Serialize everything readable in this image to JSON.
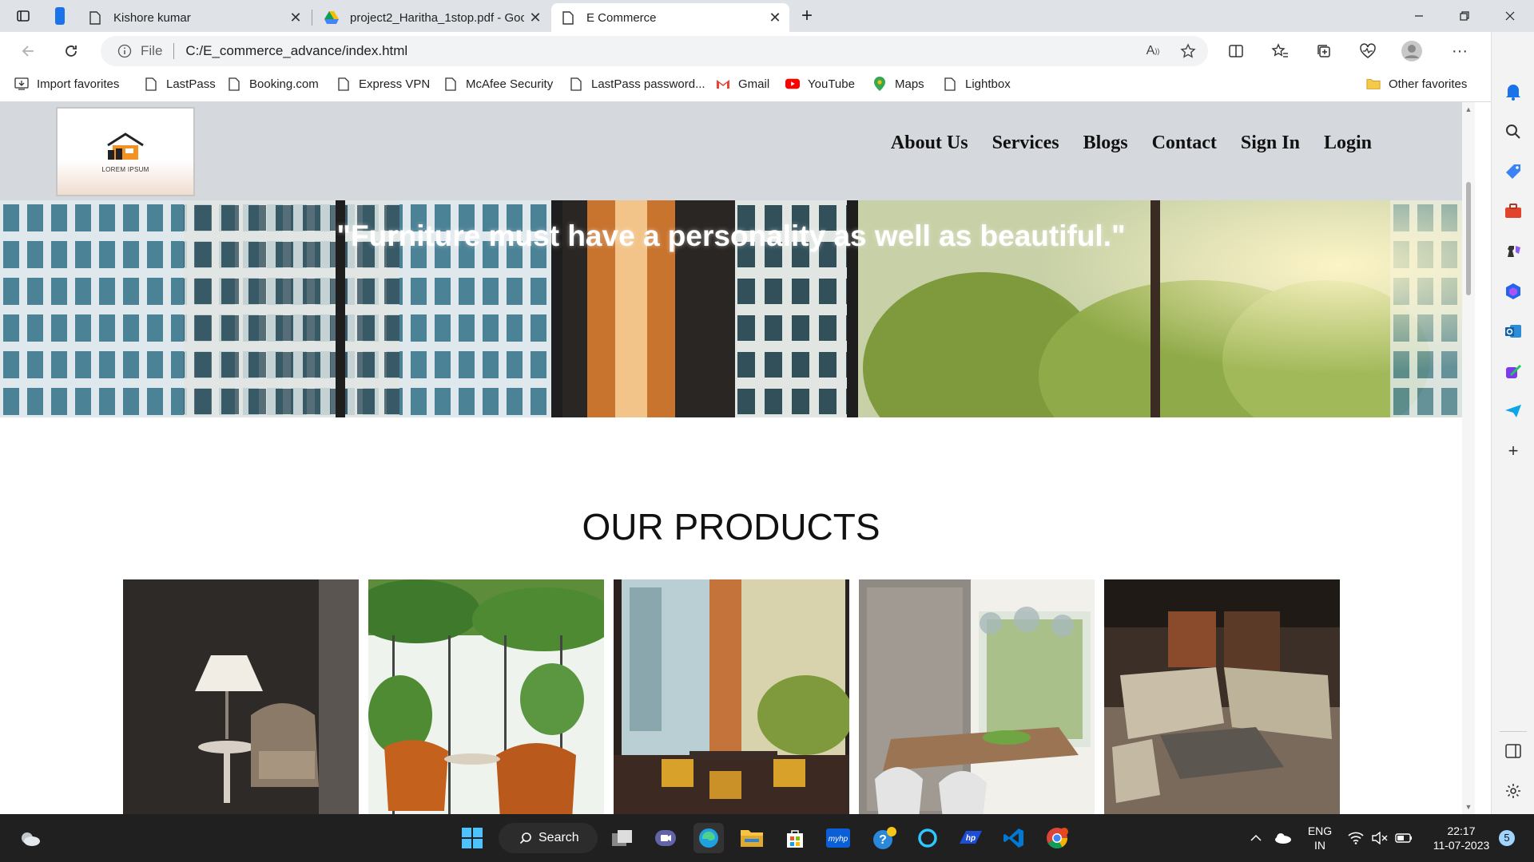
{
  "browser": {
    "tabs": [
      {
        "label": "Kishore kumar",
        "active": false
      },
      {
        "label": "project2_Haritha_1stop.pdf - Goo",
        "active": false
      },
      {
        "label": "E Commerce",
        "active": true
      }
    ],
    "address": {
      "scheme_label": "File",
      "url": "C:/E_commerce_advance/index.html"
    },
    "favorites": [
      {
        "label": "Import favorites",
        "icon": "import-icon"
      },
      {
        "label": "LastPass",
        "icon": "page-icon"
      },
      {
        "label": "Booking.com",
        "icon": "page-icon"
      },
      {
        "label": "Express VPN",
        "icon": "page-icon"
      },
      {
        "label": "McAfee Security",
        "icon": "page-icon"
      },
      {
        "label": "LastPass password...",
        "icon": "page-icon"
      },
      {
        "label": "Gmail",
        "icon": "gmail-icon"
      },
      {
        "label": "YouTube",
        "icon": "youtube-icon"
      },
      {
        "label": "Maps",
        "icon": "maps-icon"
      },
      {
        "label": "Lightbox",
        "icon": "page-icon"
      }
    ],
    "other_favorites": "Other favorites"
  },
  "site": {
    "logo_text": "LOREM IPSUM",
    "nav": [
      "About Us",
      "Services",
      "Blogs",
      "Contact",
      "Sign In",
      "Login"
    ],
    "hero_quote": "\"Furniture must have a personality as well as beautiful.\"",
    "products_title": "OUR PRODUCTS",
    "products": [
      {
        "name": "lamp-armchair-image"
      },
      {
        "name": "plant-cafe-image"
      },
      {
        "name": "window-lounge-image"
      },
      {
        "name": "dining-room-image"
      },
      {
        "name": "sofa-showroom-image"
      }
    ]
  },
  "taskbar": {
    "search_label": "Search",
    "language": "ENG",
    "region": "IN",
    "time": "22:17",
    "date": "11-07-2023",
    "notification_count": "5"
  },
  "colors": {
    "header_bg": "#d5d9dd",
    "tabstrip_bg": "#dfe3e8",
    "taskbar_bg": "#202020",
    "edge_blue": "#0078d4"
  }
}
